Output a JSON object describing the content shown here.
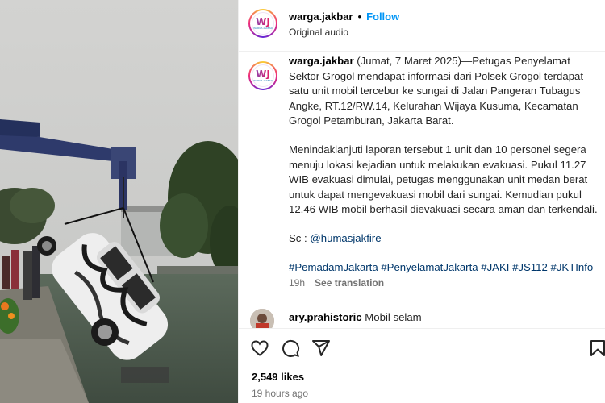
{
  "post": {
    "username": "warga.jakbar",
    "follow_label": "Follow",
    "audio": "Original audio",
    "avatar_logo_text": "WJ",
    "avatar_logo_subtext": "WARGA JAKBAR"
  },
  "caption": {
    "username": "warga.jakbar",
    "paragraph1": " (Jumat, 7 Maret 2025)—Petugas Penyelamat Sektor Grogol mendapat informasi dari Polsek Grogol terdapat satu unit mobil tercebur ke sungai di Jalan Pangeran Tubagus Angke, RT.12/RW.14, Kelurahan Wijaya Kusuma, Kecamatan Grogol Petamburan, Jakarta Barat.",
    "paragraph2": "Menindaklanjuti laporan tersebut 1 unit dan 10 personel segera menuju lokasi kejadian untuk melakukan evakuasi. Pukul 11.27 WIB evakuasi dimulai, petugas menggunakan unit medan berat untuk dapat mengevakuasi mobil dari sungai. Kemudian pukul 12.46 WIB mobil berhasil dievakuasi secara aman dan terkendali.",
    "source_prefix": "Sc : ",
    "source_mention": "@humasjakfire",
    "hashtags": "#PemadamJakarta #PenyelamatJakarta #JAKI #JS112 #JKTInfo",
    "time_ago": "19h",
    "see_translation": "See translation"
  },
  "comment": {
    "username": "ary.prahistoric",
    "text": " Mobil selam"
  },
  "actions": {
    "likes": "2,549 likes",
    "posted": "19 hours ago",
    "icons": [
      "heart-icon",
      "comment-icon",
      "share-icon",
      "bookmark-icon"
    ]
  },
  "colors": {
    "link_blue": "#0095f6",
    "hashtag_blue": "#00376b",
    "muted_gray": "#737373"
  }
}
